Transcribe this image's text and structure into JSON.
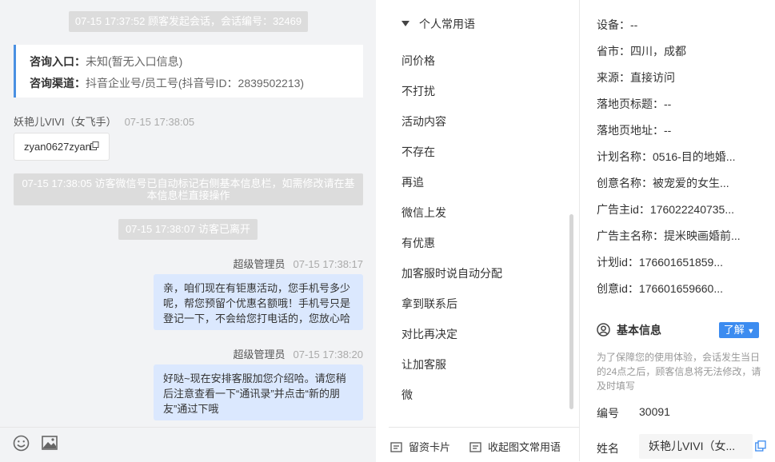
{
  "chat": {
    "sys_session_start": "07-15 17:37:52 顾客发起会话，会话编号：32469",
    "info_card": {
      "entry_label": "咨询入口：",
      "entry_value": "未知(暂无入口信息)",
      "channel_label": "咨询渠道：",
      "channel_value": "抖音企业号/员工号(抖音号ID：2839502213)"
    },
    "visitor_msg": {
      "sender": "妖艳儿VIVI（女飞手）",
      "time": "07-15 17:38:05",
      "copy_text": "zyan0627zyan"
    },
    "sys_wechat_mark_line1": "07-15 17:38:05 访客微信号已自动标记右侧基本信息栏，如需修改请在基",
    "sys_wechat_mark_line2": "本信息栏直接操作",
    "sys_visitor_left": "07-15 17:38:07 访客已离开",
    "messages": [
      {
        "sender": "超级管理员",
        "time": "07-15 17:38:17",
        "lines": [
          "亲，咱们现在有钜惠活动，您手机号多少",
          "呢，帮您预留个优惠名额哦！手机号只是",
          "登记一下，不会给您打电话的，您放心哈"
        ]
      },
      {
        "sender": "超级管理员",
        "time": "07-15 17:38:20",
        "lines": [
          "好哒~现在安排客服加您介绍哈。请您稍",
          "后注意查看一下“通讯录”并点击“新的朋",
          "友”通过下哦"
        ]
      }
    ],
    "toolbar": {
      "emoji_icon": "smiley-icon",
      "image_icon": "image-icon"
    }
  },
  "phrases": {
    "header": "个人常用语",
    "items": [
      "问价格",
      "不打扰",
      "活动内容",
      "不存在",
      "再追",
      "微信上发",
      "有优惠",
      "加客服时说自动分配",
      "拿到联系后",
      "对比再决定",
      "让加客服",
      "微"
    ],
    "bottom_left": "留资卡片",
    "bottom_right": "收起图文常用语"
  },
  "info": {
    "kv": [
      {
        "label": "设备：",
        "value": "--"
      },
      {
        "label": "省市：",
        "value": "四川，成都"
      },
      {
        "label": "来源：",
        "value": "直接访问"
      },
      {
        "label": "落地页标题：",
        "value": "--"
      },
      {
        "label": "落地页地址：",
        "value": "--"
      },
      {
        "label": "计划名称：",
        "value": "0516-目的地婚..."
      },
      {
        "label": "创意名称：",
        "value": "被宠爱的女生..."
      },
      {
        "label": "广告主id：",
        "value": "176022240735..."
      },
      {
        "label": "广告主名称：",
        "value": "提米映画婚前..."
      },
      {
        "label": "计划id：",
        "value": "176601651859..."
      },
      {
        "label": "创意id：",
        "value": "176601659660..."
      }
    ],
    "section_title": "基本信息",
    "learn_button": "了解",
    "notice": "为了保障您的使用体验，会话发生当日的24点之后，顾客信息将无法修改，请及时填写",
    "number_label": "编号",
    "number_value": "30091",
    "name_label": "姓名",
    "name_value": "妖艳儿VIVI（女..."
  }
}
